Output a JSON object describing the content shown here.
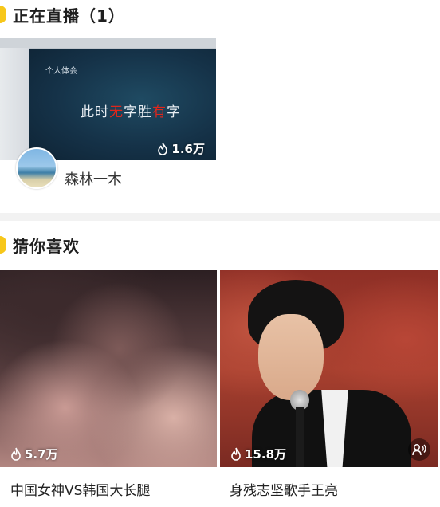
{
  "live_section": {
    "title": "正在直播（1）",
    "card": {
      "slide_small_text": "个人体会",
      "slide_text_parts": [
        "此时",
        "无",
        "字胜",
        "有",
        "字"
      ],
      "heat": "1.6万",
      "host_name": "森林一木"
    }
  },
  "recommend_section": {
    "title": "猜你喜欢",
    "items": [
      {
        "heat": "5.7万",
        "title": "中国女神VS韩国大长腿"
      },
      {
        "heat": "15.8万",
        "title": "身残志坚歌手王亮"
      }
    ]
  },
  "colors": {
    "accent": "#f7c71a",
    "slide_highlight": "#e0261c",
    "divider": "#f2f2f2"
  },
  "icons": [
    "flame-icon",
    "voice-chat-icon"
  ]
}
